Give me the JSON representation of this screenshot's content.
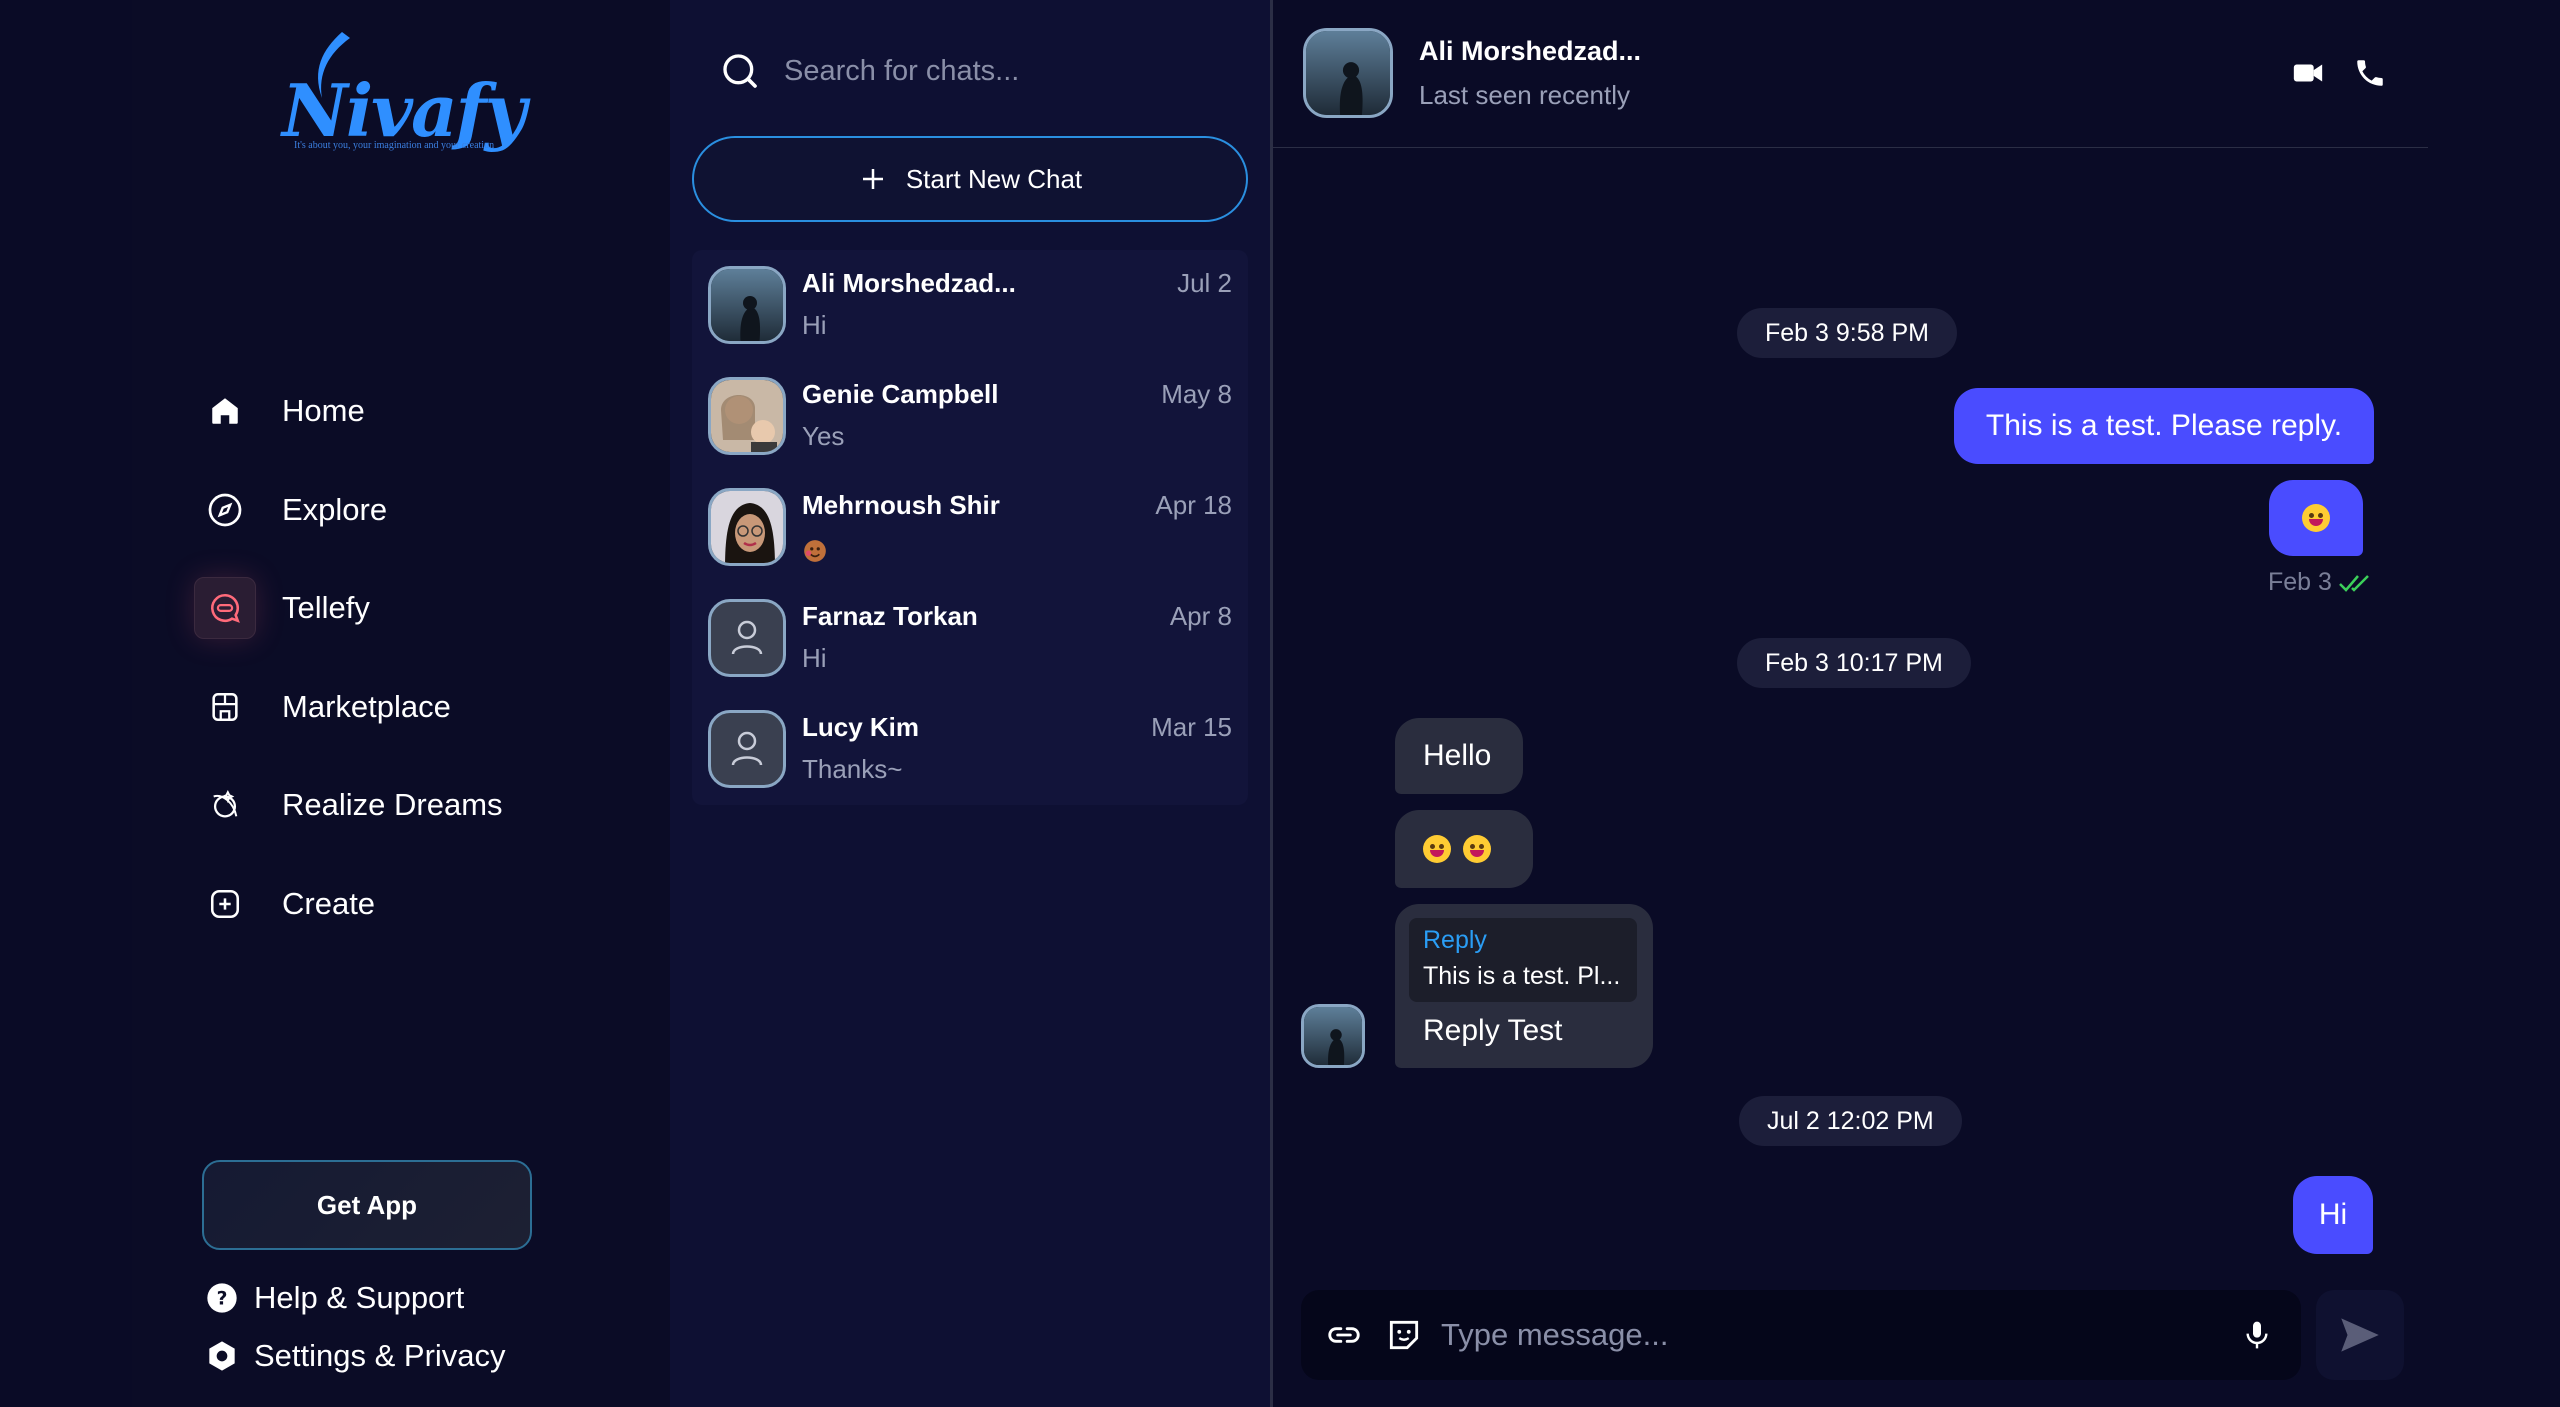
{
  "brand": {
    "name": "Nivafy",
    "tagline": "It's about you, your imagination and your creation",
    "accent": "#2f8fff"
  },
  "nav": {
    "items": [
      {
        "label": "Home",
        "icon": "home-icon"
      },
      {
        "label": "Explore",
        "icon": "compass-icon"
      },
      {
        "label": "Tellefy",
        "icon": "chat-bubble-icon",
        "active": true
      },
      {
        "label": "Marketplace",
        "icon": "store-icon"
      },
      {
        "label": "Realize Dreams",
        "icon": "dream-icon"
      },
      {
        "label": "Create",
        "icon": "plus-square-icon"
      }
    ],
    "get_app": "Get App",
    "help": "Help & Support",
    "settings": "Settings & Privacy"
  },
  "chatlist": {
    "search_placeholder": "Search for chats...",
    "new_chat": "Start New Chat",
    "items": [
      {
        "name": "Ali Morshedzad...",
        "last": "Hi",
        "date": "Jul 2",
        "avatar": "photo"
      },
      {
        "name": "Genie Campbell",
        "last": "Yes",
        "date": "May 8",
        "avatar": "photo"
      },
      {
        "name": "Mehrnoush Shir",
        "last": "",
        "date": "Apr 18",
        "avatar": "photo"
      },
      {
        "name": "Farnaz Torkan",
        "last": "Hi",
        "date": "Apr 8",
        "avatar": "default"
      },
      {
        "name": "Lucy Kim",
        "last": "Thanks~",
        "date": "Mar 15",
        "avatar": "default"
      }
    ]
  },
  "conversation": {
    "name": "Ali Morshedzad...",
    "status": "Last seen recently",
    "messages": {
      "date1": "Feb 3 9:58 PM",
      "out1": "This is a test. Please reply.",
      "out_meta": "Feb 3",
      "date2": "Feb 3 10:17 PM",
      "in1": "Hello",
      "reply_label": "Reply",
      "reply_quote": "This is a test. Pl...",
      "reply_text": "Reply Test",
      "date3": "Jul 2 12:02 PM",
      "out2": "Hi"
    },
    "composer_placeholder": "Type message..."
  },
  "colors": {
    "bubble_out": "#4a4cff",
    "bubble_in": "#2a2d3e",
    "read_check": "#3ccf5a"
  }
}
